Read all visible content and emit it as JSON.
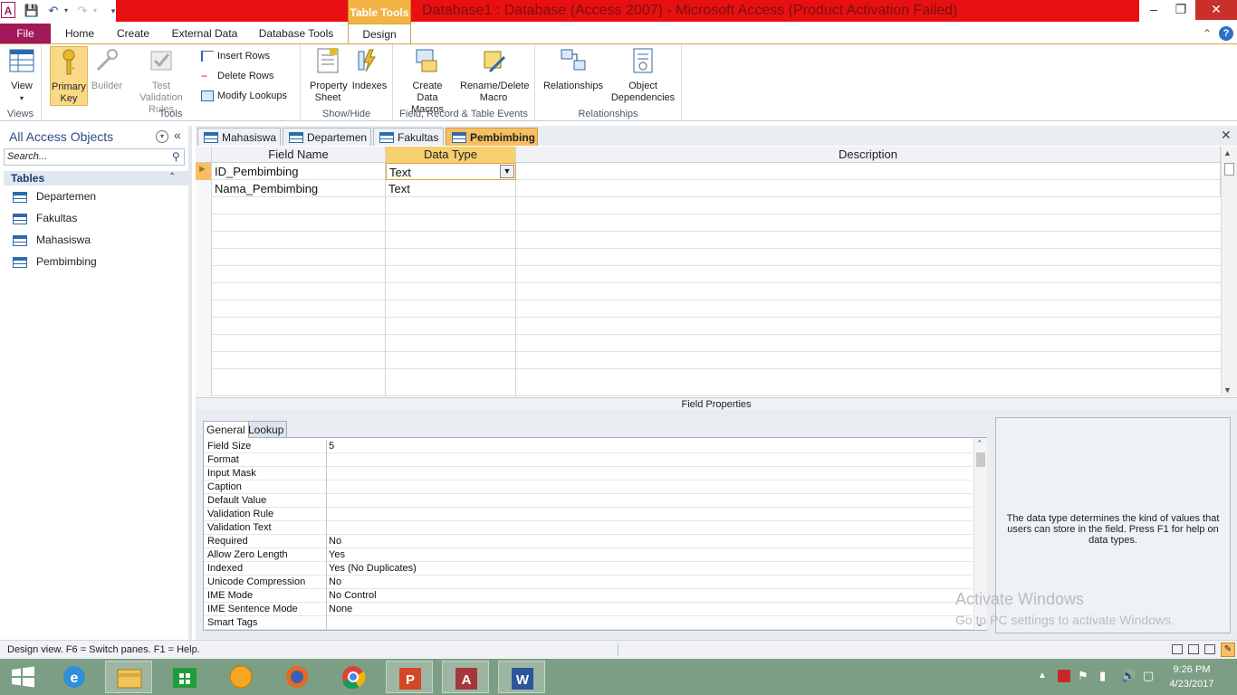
{
  "window": {
    "title": "Database1 : Database (Access 2007)  -  Microsoft Access (Product Activation Failed)",
    "context_tab": "Table Tools",
    "app_icon": "A"
  },
  "ribbon_tabs": [
    "File",
    "Home",
    "Create",
    "External Data",
    "Database Tools",
    "Design"
  ],
  "ribbon": {
    "views": {
      "view": "View",
      "group": "Views"
    },
    "tools": {
      "primary_key": "Primary Key",
      "builder": "Builder",
      "test_validation": "Test Validation Rules",
      "insert_rows": "Insert Rows",
      "delete_rows": "Delete Rows",
      "modify_lookups": "Modify Lookups",
      "group": "Tools"
    },
    "showhide": {
      "property_sheet": "Property Sheet",
      "indexes": "Indexes",
      "group": "Show/Hide"
    },
    "events": {
      "create_macros": "Create Data Macros",
      "rename_macro": "Rename/Delete Macro",
      "group": "Field, Record & Table Events"
    },
    "relationships": {
      "relationships": "Relationships",
      "object_dependencies": "Object Dependencies",
      "group": "Relationships"
    }
  },
  "nav": {
    "header": "All Access Objects",
    "search_placeholder": "Search...",
    "section": "Tables",
    "items": [
      "Departemen",
      "Fakultas",
      "Mahasiswa",
      "Pembimbing"
    ]
  },
  "doc_tabs": [
    "Mahasiswa",
    "Departemen",
    "Fakultas",
    "Pembimbing"
  ],
  "grid": {
    "headers": {
      "field": "Field Name",
      "type": "Data Type",
      "desc": "Description"
    },
    "rows": [
      {
        "field": "ID_Pembimbing",
        "type": "Text",
        "desc": ""
      },
      {
        "field": "Nama_Pembimbing",
        "type": "Text",
        "desc": ""
      }
    ]
  },
  "field_properties": {
    "title": "Field Properties",
    "tabs": [
      "General",
      "Lookup"
    ],
    "rows": [
      {
        "k": "Field Size",
        "v": "5"
      },
      {
        "k": "Format",
        "v": ""
      },
      {
        "k": "Input Mask",
        "v": ""
      },
      {
        "k": "Caption",
        "v": ""
      },
      {
        "k": "Default Value",
        "v": ""
      },
      {
        "k": "Validation Rule",
        "v": ""
      },
      {
        "k": "Validation Text",
        "v": ""
      },
      {
        "k": "Required",
        "v": "No"
      },
      {
        "k": "Allow Zero Length",
        "v": "Yes"
      },
      {
        "k": "Indexed",
        "v": "Yes (No Duplicates)"
      },
      {
        "k": "Unicode Compression",
        "v": "No"
      },
      {
        "k": "IME Mode",
        "v": "No Control"
      },
      {
        "k": "IME Sentence Mode",
        "v": "None"
      },
      {
        "k": "Smart Tags",
        "v": ""
      }
    ],
    "help": "The data type determines the kind of values that users can store in the field. Press F1 for help on data types."
  },
  "watermark": {
    "line1": "Activate Windows",
    "line2": "Go to PC settings to activate Windows."
  },
  "status": "Design view.  F6 = Switch panes.  F1 = Help.",
  "clock": {
    "time": "9:26 PM",
    "date": "4/23/2017"
  },
  "colors": {
    "title_red": "#e81010",
    "file_tab": "#a1185b",
    "active_tab": "#f6c062",
    "taskbar": "#7c9e84"
  }
}
